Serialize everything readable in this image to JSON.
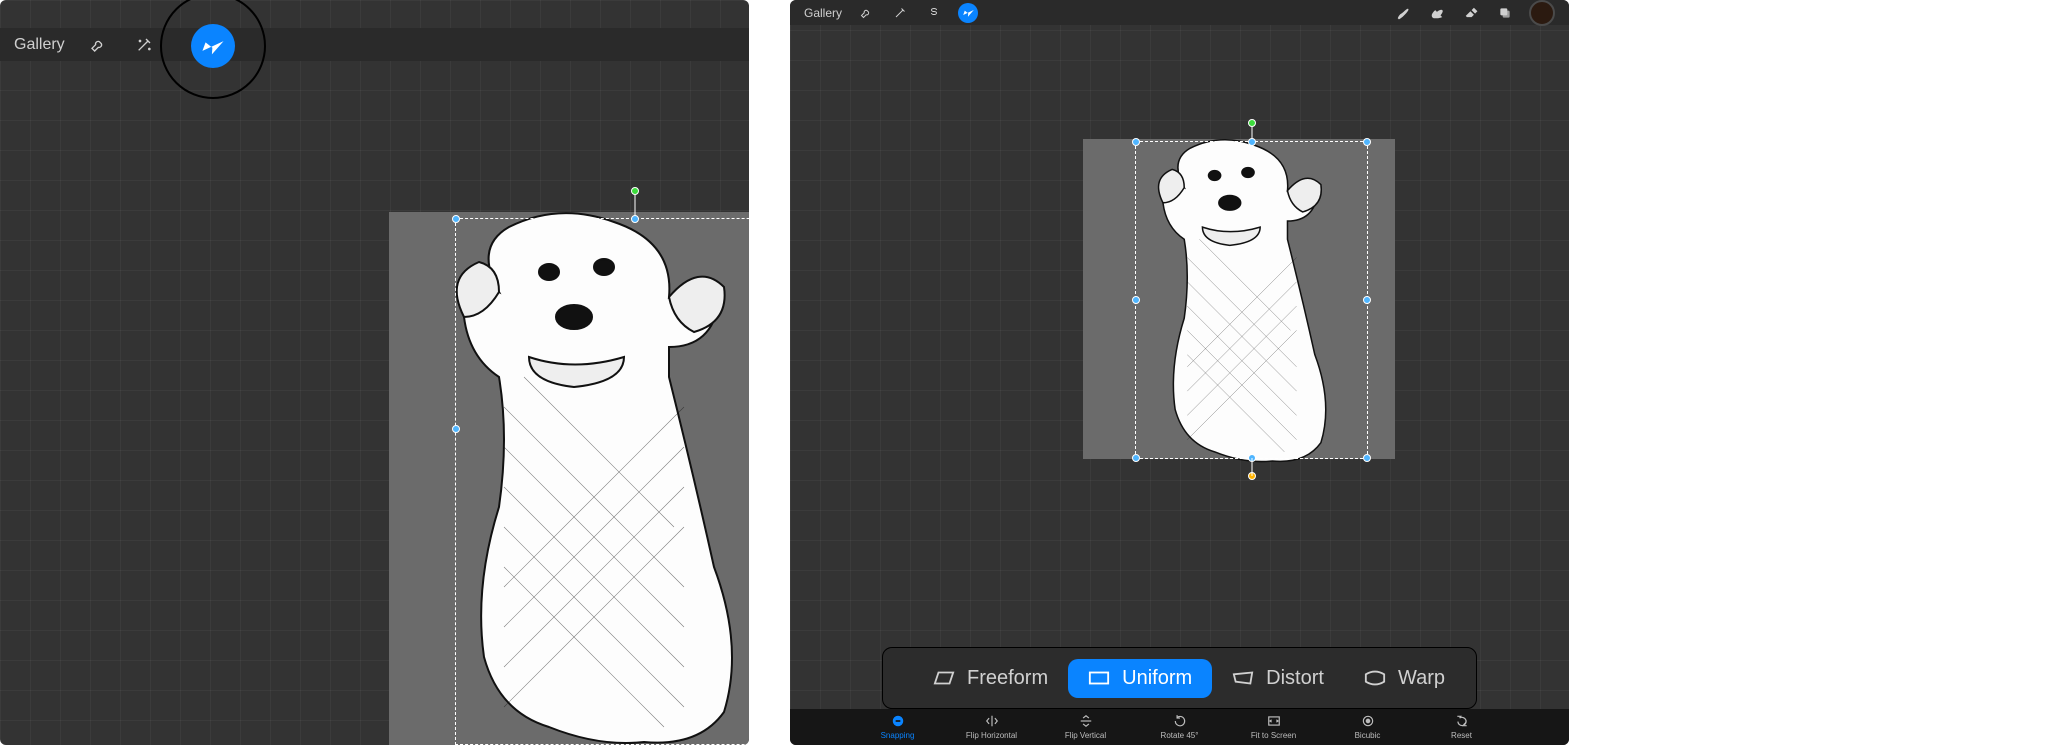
{
  "accent_color": "#0a84ff",
  "left": {
    "toolbar": {
      "gallery_label": "Gallery"
    }
  },
  "right": {
    "toolbar": {
      "gallery_label": "Gallery"
    },
    "transform_modes": [
      {
        "label": "Freeform",
        "active": false
      },
      {
        "label": "Uniform",
        "active": true
      },
      {
        "label": "Distort",
        "active": false
      },
      {
        "label": "Warp",
        "active": false
      }
    ],
    "transform_actions": [
      {
        "label": "Snapping",
        "active": true
      },
      {
        "label": "Flip Horizontal",
        "active": false
      },
      {
        "label": "Flip Vertical",
        "active": false
      },
      {
        "label": "Rotate 45°",
        "active": false
      },
      {
        "label": "Fit to Screen",
        "active": false
      },
      {
        "label": "Bicubic",
        "active": false
      },
      {
        "label": "Reset",
        "active": false
      }
    ]
  }
}
